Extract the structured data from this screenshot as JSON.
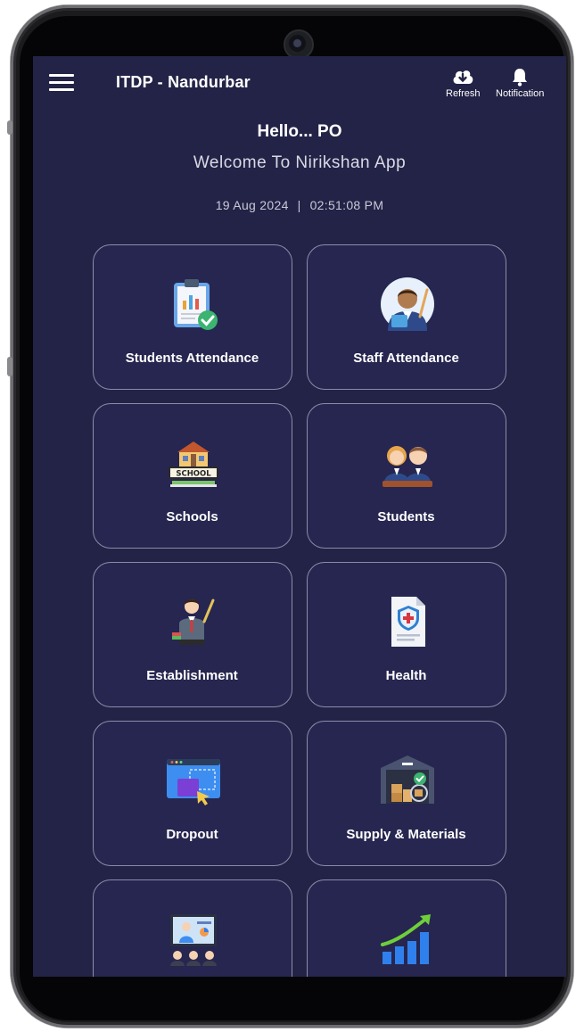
{
  "appbar": {
    "title": "ITDP - Nandurbar",
    "refresh_label": "Refresh",
    "notification_label": "Notification"
  },
  "greeting": {
    "hello": "Hello... PO",
    "welcome": "Welcome To Nirikshan App",
    "date": "19 Aug 2024",
    "separator": "|",
    "time": "02:51:08 PM"
  },
  "menu": [
    {
      "label": "Students Attendance",
      "icon": "clipboard-chart-icon"
    },
    {
      "label": "Staff Attendance",
      "icon": "teacher-icon"
    },
    {
      "label": "Schools",
      "icon": "school-building-icon"
    },
    {
      "label": "Students",
      "icon": "students-icon"
    },
    {
      "label": "Establishment",
      "icon": "teacher-pointer-icon"
    },
    {
      "label": "Health",
      "icon": "health-document-icon"
    },
    {
      "label": "Dropout",
      "icon": "dropout-window-icon"
    },
    {
      "label": "Supply & Materials",
      "icon": "warehouse-icon"
    },
    {
      "label": "",
      "icon": "presentation-icon"
    },
    {
      "label": "",
      "icon": "growth-chart-icon"
    }
  ],
  "colors": {
    "screen_bg": "#232347",
    "card_bg": "#262650",
    "card_border": "#8b8ba8"
  }
}
